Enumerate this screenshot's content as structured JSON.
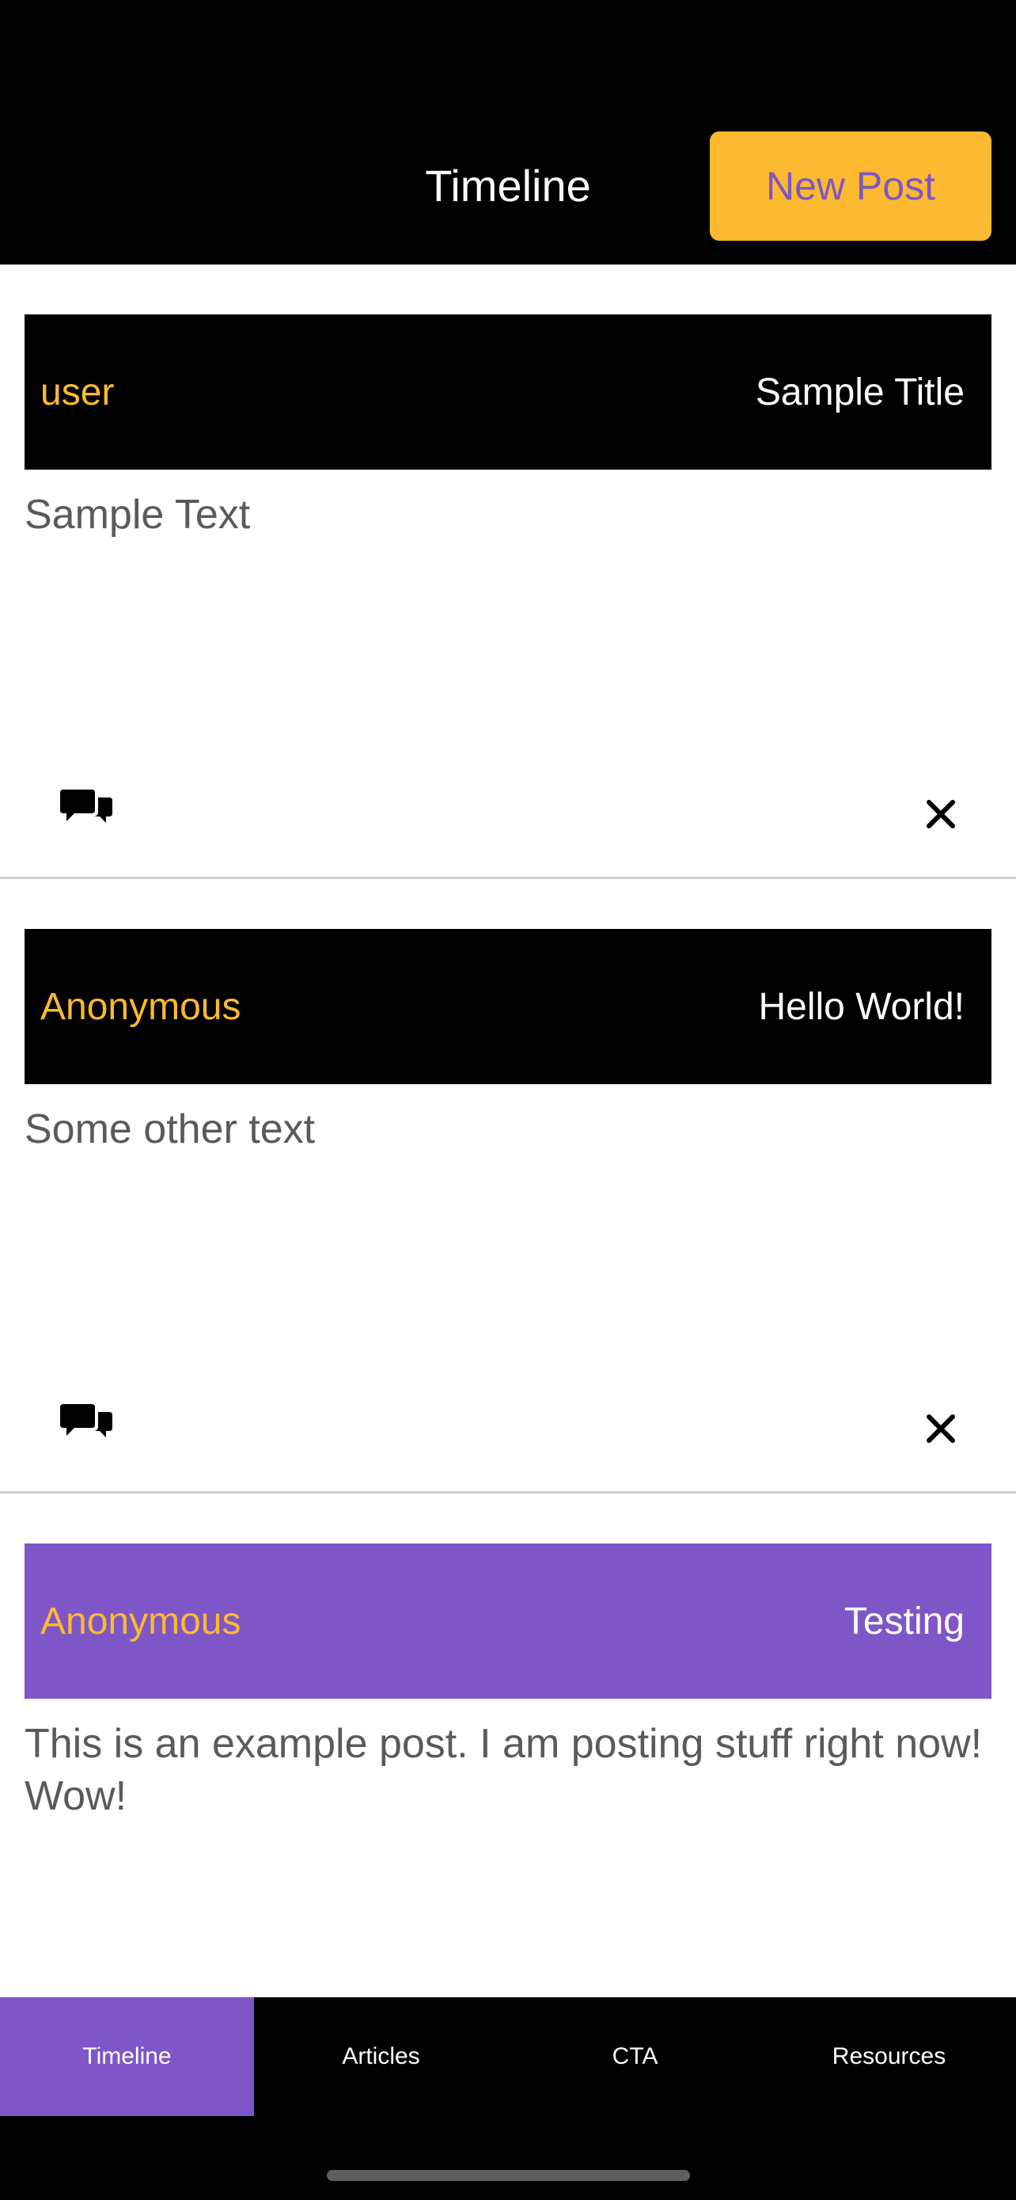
{
  "header": {
    "title": "Timeline",
    "new_post_label": "New Post"
  },
  "colors": {
    "accent_yellow": "#fdb92f",
    "accent_purple": "#7f56c7",
    "post_header_default": "#000000",
    "body_text": "#5a5a5a"
  },
  "posts": [
    {
      "user": "user",
      "title": "Sample Title",
      "body": "Sample Text",
      "header_color": "#000000",
      "comment_icon": "comment-bubbles-icon",
      "delete_icon": "close-icon"
    },
    {
      "user": "Anonymous",
      "title": "Hello World!",
      "body": "Some other text",
      "header_color": "#000000",
      "comment_icon": "comment-bubbles-icon",
      "delete_icon": "close-icon"
    },
    {
      "user": "Anonymous",
      "title": "Testing",
      "body": "This is an example post. I am posting stuff right now! Wow!",
      "header_color": "#7f56c7"
    }
  ],
  "tabs": [
    {
      "label": "Timeline",
      "active": true
    },
    {
      "label": "Articles",
      "active": false
    },
    {
      "label": "CTA",
      "active": false
    },
    {
      "label": "Resources",
      "active": false
    }
  ]
}
